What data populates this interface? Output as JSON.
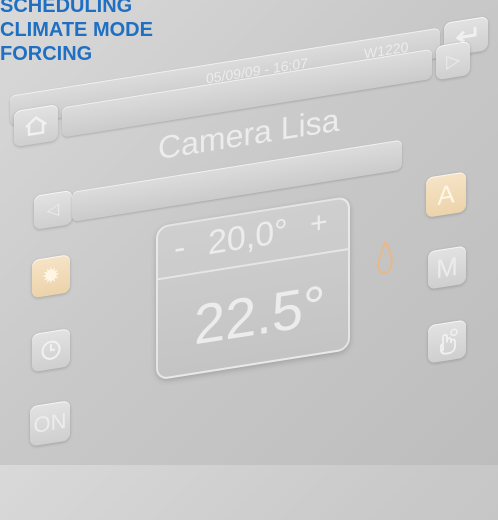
{
  "menu": [
    "SCHEDULING",
    "CLIMATE MODE",
    "FORCING"
  ],
  "header": {
    "datetime": "05/09/09 - 16:07",
    "device": "W1220"
  },
  "room": {
    "name": "Camera Lisa"
  },
  "setpoint": {
    "minus": "-",
    "value": "20,0°",
    "plus": "+"
  },
  "temperature": {
    "current": "22.5°"
  },
  "modes": {
    "auto": "A",
    "manual": "M"
  },
  "power": {
    "label": "ON"
  },
  "colors": {
    "menu": "#1f6fc2",
    "warm_button": "#f2dcb6",
    "flame": "#e9b887"
  }
}
